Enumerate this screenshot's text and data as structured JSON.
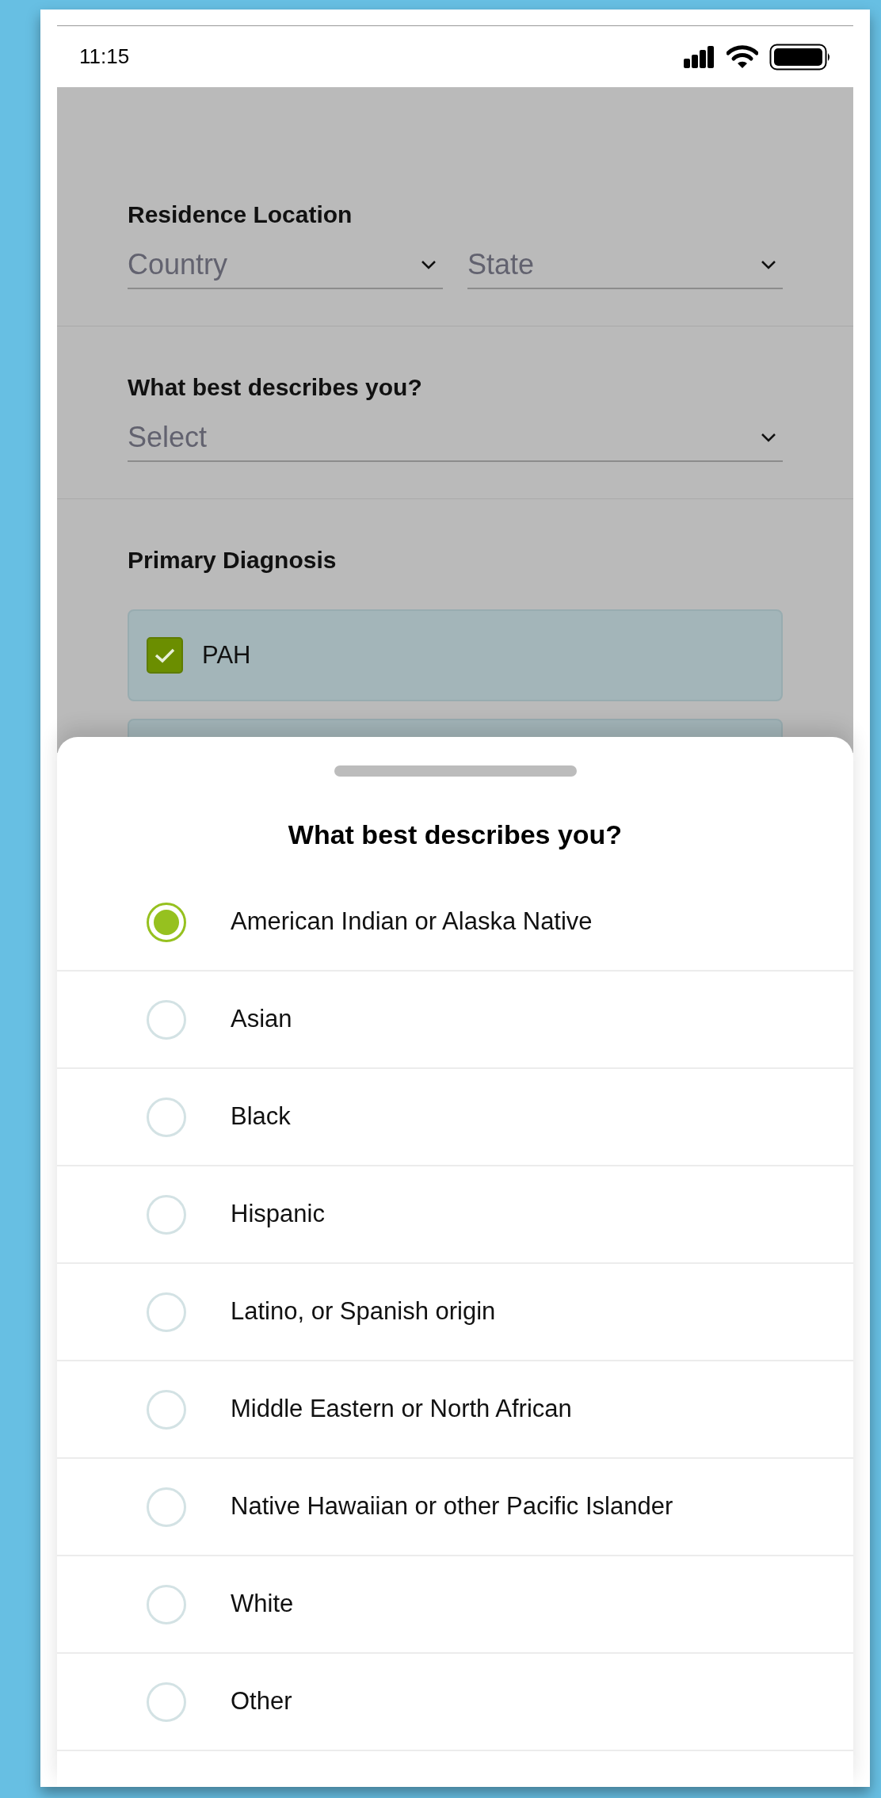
{
  "status_bar": {
    "time": "11:15"
  },
  "form": {
    "sections": [
      {
        "kind": "dropdowns",
        "label": "Residence Location",
        "fields": [
          {
            "placeholder": "Country"
          },
          {
            "placeholder": "State"
          }
        ]
      },
      {
        "kind": "dropdowns",
        "label": "What best describes you?",
        "fields": [
          {
            "placeholder": "Select"
          }
        ]
      },
      {
        "kind": "checkboxes",
        "label": "Primary Diagnosis",
        "options": [
          {
            "label": "PAH",
            "checked": true
          }
        ]
      }
    ]
  },
  "sheet": {
    "title": "What best describes you?",
    "options": [
      {
        "label": "American Indian or Alaska Native",
        "selected": true
      },
      {
        "label": "Asian",
        "selected": false
      },
      {
        "label": "Black",
        "selected": false
      },
      {
        "label": "Hispanic",
        "selected": false
      },
      {
        "label": "Latino, or Spanish origin",
        "selected": false
      },
      {
        "label": "Middle Eastern or North African",
        "selected": false
      },
      {
        "label": "Native Hawaiian or other Pacific Islander",
        "selected": false
      },
      {
        "label": "White",
        "selected": false
      },
      {
        "label": "Other",
        "selected": false
      }
    ]
  }
}
